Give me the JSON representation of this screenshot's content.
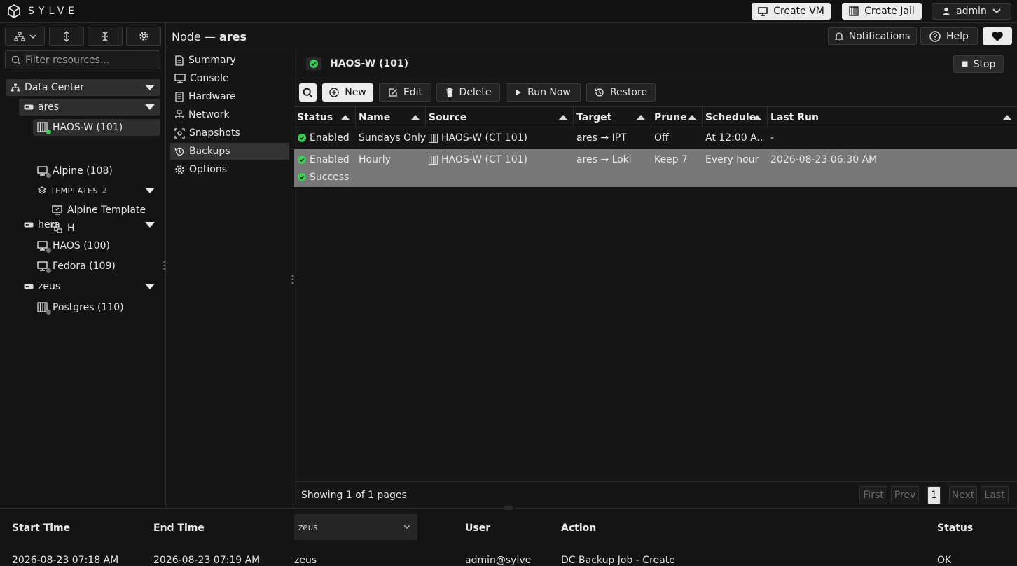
{
  "brand": {
    "name": "SYLVE"
  },
  "topbar": {
    "create_vm": "Create VM",
    "create_jail": "Create Jail",
    "user": "admin"
  },
  "sidebar": {
    "filter_placeholder": "Filter resources...",
    "datacenter": "Data Center",
    "nodes": [
      {
        "name": "ares"
      },
      {
        "name": "hera"
      },
      {
        "name": "zeus"
      }
    ],
    "ares_items": [
      "HAOS-W (101)",
      "Alpine (108)"
    ],
    "templates_label": "TEMPLATES",
    "templates_count": "2",
    "template_items": [
      "Alpine Template",
      "H"
    ],
    "hera_items": [
      "HAOS (100)",
      "Fedora (109)"
    ],
    "zeus_items": [
      "Postgres (110)"
    ]
  },
  "header": {
    "node_prefix": "Node —",
    "node_name": "ares",
    "notifications": "Notifications",
    "help": "Help"
  },
  "nav": {
    "items": [
      "Summary",
      "Console",
      "Hardware",
      "Network",
      "Snapshots",
      "Backups",
      "Options"
    ]
  },
  "vm": {
    "title": "HAOS-W (101)",
    "stop": "Stop"
  },
  "actions": {
    "new": "New",
    "edit": "Edit",
    "delete": "Delete",
    "run_now": "Run Now",
    "restore": "Restore"
  },
  "table": {
    "columns": [
      "Status",
      "Name",
      "Source",
      "Target",
      "Prune",
      "Schedule",
      "Last Run"
    ],
    "rows": [
      {
        "status": "Enabled",
        "name": "Sundays Only",
        "source": "HAOS-W (CT 101)",
        "target": "ares → IPT",
        "prune": "Off",
        "schedule": "At 12:00 A...",
        "last_run": "-",
        "last_status": ""
      },
      {
        "status": "Enabled",
        "name": "Hourly",
        "source": "HAOS-W (CT 101)",
        "target": "ares → Loki",
        "prune": "Keep 7",
        "schedule": "Every hour",
        "last_run": "2026-08-23 06:30 AM",
        "last_status": "Success"
      }
    ]
  },
  "pagination": {
    "summary": "Showing 1 of 1 pages",
    "first": "First",
    "prev": "Prev",
    "current": "1",
    "next": "Next",
    "last": "Last"
  },
  "tasks": {
    "columns": [
      "Start Time",
      "End Time",
      "User",
      "Action",
      "Status"
    ],
    "node_filter": "zeus",
    "rows": [
      {
        "start": "2026-08-23 07:18 AM",
        "end": "2026-08-23 07:19 AM",
        "node": "zeus",
        "user": "admin@sylve",
        "action": "DC Backup Job - Create",
        "status": "OK"
      }
    ]
  },
  "colors": {
    "accent_green": "#3ecb55",
    "selected_row": "#787878"
  }
}
